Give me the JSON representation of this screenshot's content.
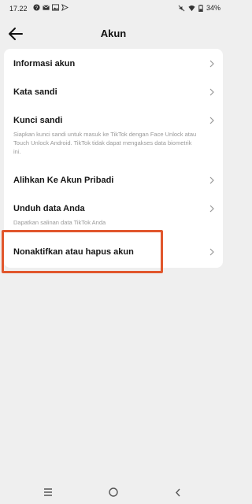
{
  "status": {
    "time": "17.22",
    "battery": "34%",
    "left_icons": [
      "help-circle-icon",
      "mail-icon",
      "image-icon",
      "send-icon"
    ],
    "right_icons": [
      "mute-icon",
      "wifi-icon",
      "battery-icon"
    ]
  },
  "header": {
    "title": "Akun",
    "back_icon": "arrow-left-icon"
  },
  "items": [
    {
      "label": "Informasi akun"
    },
    {
      "label": "Kata sandi"
    },
    {
      "label": "Kunci sandi",
      "desc": "Siapkan kunci sandi untuk masuk ke TikTok dengan Face Unlock atau Touch Unlock Android. TikTok tidak dapat mengakses data biometrik ini."
    },
    {
      "label": "Alihkan Ke Akun Pribadi"
    },
    {
      "label": "Unduh data Anda",
      "desc": "Dapatkan salinan data TikTok Anda"
    },
    {
      "label": "Nonaktifkan atau hapus akun"
    }
  ],
  "highlight_color": "#e1562c",
  "navbar": [
    "menu-icon",
    "home-circle-icon",
    "back-chevron-icon"
  ]
}
